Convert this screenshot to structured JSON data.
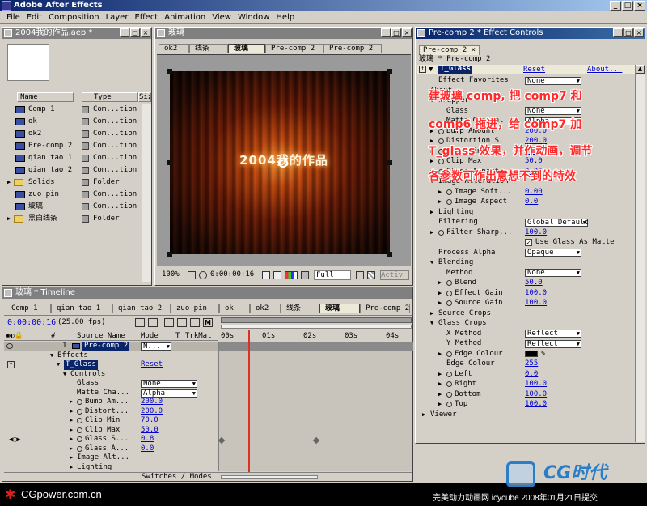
{
  "app": {
    "title": "Adobe After Effects"
  },
  "menu": [
    "File",
    "Edit",
    "Composition",
    "Layer",
    "Effect",
    "Animation",
    "View",
    "Window",
    "Help"
  ],
  "project": {
    "title": "2004我的作品.aep *",
    "columns": [
      "Name",
      "Type",
      "Siz"
    ],
    "items": [
      {
        "name": "Comp 1",
        "type": "Com...tion",
        "kind": "comp"
      },
      {
        "name": "ok",
        "type": "Com...tion",
        "kind": "comp"
      },
      {
        "name": "ok2",
        "type": "Com...tion",
        "kind": "comp"
      },
      {
        "name": "Pre-comp 2",
        "type": "Com...tion",
        "kind": "comp"
      },
      {
        "name": "qian tao 1",
        "type": "Com...tion",
        "kind": "comp"
      },
      {
        "name": "qian tao 2",
        "type": "Com...tion",
        "kind": "comp"
      },
      {
        "name": "Solids",
        "type": "Folder",
        "kind": "folder"
      },
      {
        "name": "zuo pin",
        "type": "Com...tion",
        "kind": "comp"
      },
      {
        "name": "玻璃",
        "type": "Com...tion",
        "kind": "comp"
      },
      {
        "name": "黑白线条",
        "type": "Folder",
        "kind": "folder"
      }
    ]
  },
  "comp": {
    "title": "玻璃",
    "tabs": [
      "ok2",
      "线条",
      "玻璃",
      "Pre-comp 2",
      "Pre-comp 2"
    ],
    "active_tab": 2,
    "frame_text": "2004我的作品",
    "zoom": "100%",
    "timecode": "0:00:00:16",
    "resolution": "Full",
    "active_label": "Activ"
  },
  "effect_controls": {
    "title": "Pre-comp 2 * Effect Controls",
    "tab": "Pre-comp 2",
    "path": "玻璃 * Pre-comp 2",
    "effect_name": "T_Glass",
    "reset": "Reset",
    "about": "About...",
    "rows": [
      {
        "indent": 1,
        "label": "Effect Favorites",
        "value": "None",
        "vtype": "dropdown",
        "arrow": ""
      },
      {
        "indent": 0,
        "label": "About...",
        "value": "",
        "vtype": "text",
        "arrow": ""
      },
      {
        "indent": 1,
        "label": "Wrapper",
        "value": "",
        "vtype": "text",
        "arrow": "▼"
      },
      {
        "indent": 2,
        "label": "Glass",
        "value": "None",
        "vtype": "dropdown",
        "arrow": ""
      },
      {
        "indent": 2,
        "label": "Matte Channel",
        "value": "Alpha",
        "vtype": "dropdown",
        "arrow": ""
      },
      {
        "indent": 1,
        "label": "Bump Amount",
        "value": "200.0",
        "vtype": "num",
        "arrow": "▶",
        "sw": true
      },
      {
        "indent": 1,
        "label": "Distortion S.",
        "value": "200.0",
        "vtype": "num",
        "arrow": "▶",
        "sw": true
      },
      {
        "indent": 1,
        "label": "Clip Min",
        "value": "70.0",
        "vtype": "num",
        "arrow": "▶",
        "sw": true
      },
      {
        "indent": 1,
        "label": "Clip Max",
        "value": "50.0",
        "vtype": "num",
        "arrow": "▶",
        "sw": true
      },
      {
        "indent": 1,
        "label": "Glass Aspect",
        "value": "0.00",
        "vtype": "num",
        "arrow": "▶",
        "sw": true
      },
      {
        "indent": 1,
        "label": "Image Alteration",
        "value": "",
        "vtype": "text",
        "arrow": "▼"
      },
      {
        "indent": 2,
        "label": "Image Soft...",
        "value": "0.00",
        "vtype": "num",
        "arrow": "▶",
        "sw": true
      },
      {
        "indent": 2,
        "label": "Image Aspect",
        "value": "0.0",
        "vtype": "num",
        "arrow": "▶",
        "sw": true
      },
      {
        "indent": 1,
        "label": "Lighting",
        "value": "",
        "vtype": "text",
        "arrow": "▶"
      },
      {
        "indent": 1,
        "label": "Filtering",
        "value": "Global Default",
        "vtype": "dropdown",
        "arrow": ""
      },
      {
        "indent": 1,
        "label": "Filter Sharp...",
        "value": "100.0",
        "vtype": "num",
        "arrow": "▶",
        "sw": true
      },
      {
        "indent": 1,
        "label": "",
        "value": "Use Glass As Matte",
        "vtype": "check",
        "arrow": ""
      },
      {
        "indent": 1,
        "label": "Process Alpha",
        "value": "Opaque",
        "vtype": "dropdown",
        "arrow": ""
      },
      {
        "indent": 1,
        "label": "Blending",
        "value": "",
        "vtype": "text",
        "arrow": "▼"
      },
      {
        "indent": 2,
        "label": "Method",
        "value": "None",
        "vtype": "dropdown",
        "arrow": ""
      },
      {
        "indent": 2,
        "label": "Blend",
        "value": "50.0",
        "vtype": "num",
        "arrow": "▶",
        "sw": true
      },
      {
        "indent": 2,
        "label": "Effect Gain",
        "value": "100.0",
        "vtype": "num",
        "arrow": "▶",
        "sw": true
      },
      {
        "indent": 2,
        "label": "Source Gain",
        "value": "100.0",
        "vtype": "num",
        "arrow": "▶",
        "sw": true
      },
      {
        "indent": 1,
        "label": "Source Crops",
        "value": "",
        "vtype": "text",
        "arrow": "▶"
      },
      {
        "indent": 1,
        "label": "Glass Crops",
        "value": "",
        "vtype": "text",
        "arrow": "▼"
      },
      {
        "indent": 2,
        "label": "X Method",
        "value": "Reflect",
        "vtype": "dropdown",
        "arrow": ""
      },
      {
        "indent": 2,
        "label": "Y Method",
        "value": "Reflect",
        "vtype": "dropdown",
        "arrow": ""
      },
      {
        "indent": 2,
        "label": "Edge Colour",
        "value": "",
        "vtype": "color",
        "arrow": "▶",
        "sw": true
      },
      {
        "indent": 2,
        "label": "Edge Colour",
        "value": "255",
        "vtype": "num",
        "arrow": ""
      },
      {
        "indent": 2,
        "label": "Left",
        "value": "0.0",
        "vtype": "num",
        "arrow": "▶",
        "sw": true
      },
      {
        "indent": 2,
        "label": "Right",
        "value": "100.0",
        "vtype": "num",
        "arrow": "▶",
        "sw": true
      },
      {
        "indent": 2,
        "label": "Bottom",
        "value": "100.0",
        "vtype": "num",
        "arrow": "▶",
        "sw": true
      },
      {
        "indent": 2,
        "label": "Top",
        "value": "100.0",
        "vtype": "num",
        "arrow": "▶",
        "sw": true
      },
      {
        "indent": 0,
        "label": "Viewer",
        "value": "",
        "vtype": "text",
        "arrow": "▶"
      }
    ]
  },
  "timeline": {
    "title": "玻璃 * Timeline",
    "tabs": [
      "Comp 1",
      "qian tao 1",
      "qian tao 2",
      "zuo pin",
      "ok",
      "ok2",
      "线条",
      "玻璃",
      "Pre-comp 2"
    ],
    "active_tab": 7,
    "timecode": "0:00:00:16",
    "fps": "(25.00 fps)",
    "col_headers": {
      "num": "#",
      "source": "Source Name",
      "mode": "Mode",
      "t": "T",
      "trkmat": "TrkMat"
    },
    "ruler": [
      "00s",
      "01s",
      "02s",
      "03s",
      "04s"
    ],
    "footer": "Switches / Modes",
    "rows": [
      {
        "indent": 0,
        "label": "1",
        "extra": "Pre-comp 2",
        "mode": "N...",
        "type": "layer"
      },
      {
        "indent": 1,
        "label": "Effects",
        "type": "group"
      },
      {
        "indent": 2,
        "label": "T_Glass",
        "mode": "Reset",
        "type": "effect"
      },
      {
        "indent": 3,
        "label": "Controls",
        "type": "group"
      },
      {
        "indent": 4,
        "label": "Glass",
        "mode": "None",
        "type": "dd"
      },
      {
        "indent": 4,
        "label": "Matte Cha...",
        "mode": "Alpha",
        "type": "dd"
      },
      {
        "indent": 4,
        "label": "Bump Am...",
        "mode": "200.0",
        "type": "num"
      },
      {
        "indent": 4,
        "label": "Distort...",
        "mode": "200.0",
        "type": "num"
      },
      {
        "indent": 4,
        "label": "Clip Min",
        "mode": "70.0",
        "type": "num"
      },
      {
        "indent": 4,
        "label": "Clip Max",
        "mode": "50.0",
        "type": "num"
      },
      {
        "indent": 4,
        "label": "Glass S...",
        "mode": "0.8",
        "type": "num",
        "kf": true
      },
      {
        "indent": 4,
        "label": "Glass A...",
        "mode": "0.0",
        "type": "num"
      },
      {
        "indent": 4,
        "label": "Image Alt...",
        "type": "group"
      },
      {
        "indent": 4,
        "label": "Lighting",
        "type": "group"
      }
    ]
  },
  "annotation": {
    "line1": "建玻璃 comp, 把 comp7 和",
    "line2": "comp6 拖进，给 comp7 加",
    "line3": "T_glass 效果，并作动画，调节",
    "line4": "各参数可作出意想不到的特效"
  },
  "footer": {
    "left": "CGpower.com.cn",
    "right": "完美动力动画网 icycube 2008年01月21日提交",
    "logo": "CG时代"
  }
}
